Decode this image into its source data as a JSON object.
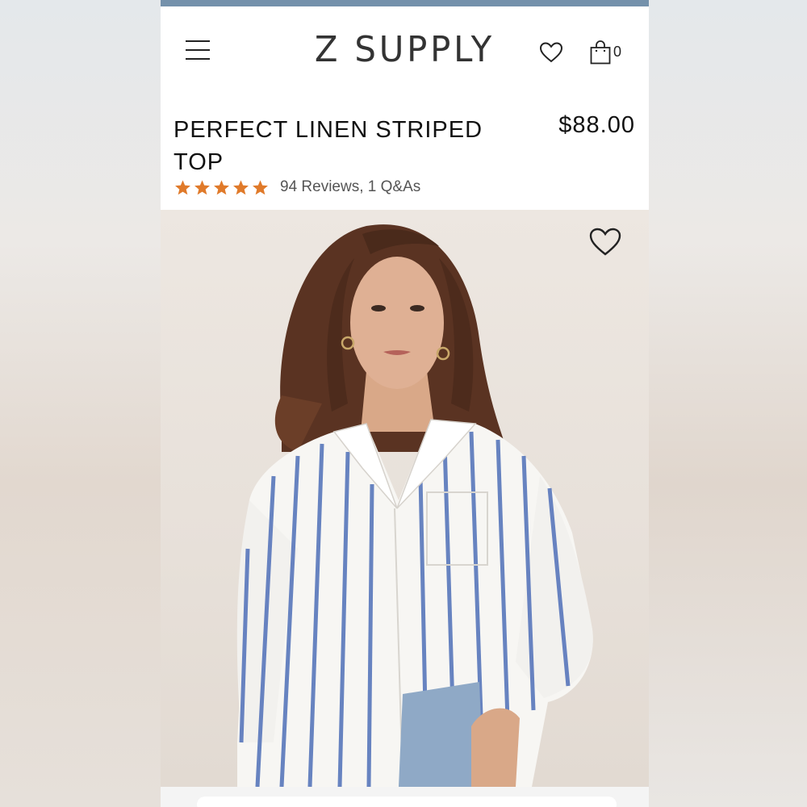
{
  "header": {
    "brand": "Z SUPPLY",
    "cart_count": "0",
    "accent_bar_color": "#7491ab"
  },
  "product": {
    "title": "PERFECT LINEN STRIPED TOP",
    "price": "$88.00",
    "rating": 5,
    "rating_max": 5,
    "star_color": "#e07a2a",
    "reviews_text": "94 Reviews, 1 Q&As"
  },
  "icons": {
    "menu": "hamburger-menu-icon",
    "wishlist": "heart-outline-icon",
    "cart": "shopping-bag-icon",
    "photo_wishlist": "heart-outline-icon"
  },
  "image": {
    "description_label": "model wearing blue and white striped linen shirt"
  }
}
